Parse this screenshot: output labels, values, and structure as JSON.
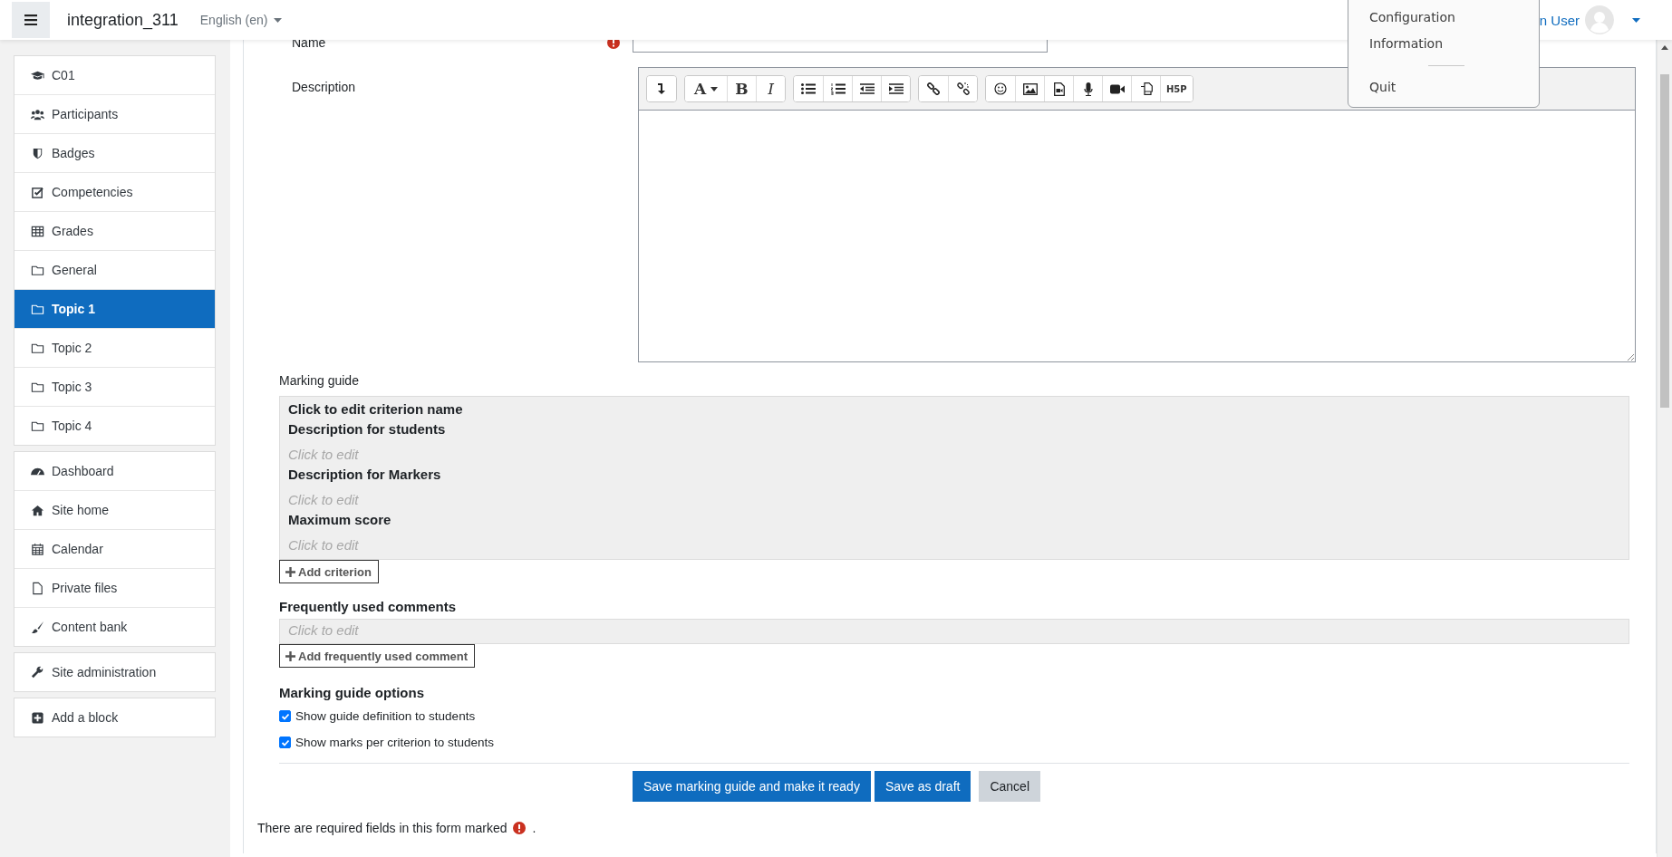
{
  "header": {
    "title": "integration_311",
    "language": "English (en)",
    "user_name": "n User"
  },
  "user_menu": {
    "items": [
      {
        "kind": "item",
        "label": "Configuration"
      },
      {
        "kind": "item",
        "label": "Information"
      },
      {
        "kind": "divider"
      },
      {
        "kind": "item",
        "label": "Quit"
      }
    ]
  },
  "sidebar": {
    "blocks": [
      {
        "items": [
          {
            "label": "C01",
            "selected": false
          },
          {
            "label": "Participants",
            "selected": false
          },
          {
            "label": "Badges",
            "selected": false
          },
          {
            "label": "Competencies",
            "selected": false
          },
          {
            "label": "Grades",
            "selected": false
          },
          {
            "label": "General",
            "selected": false
          },
          {
            "label": "Topic 1",
            "selected": true
          },
          {
            "label": "Topic 2",
            "selected": false
          },
          {
            "label": "Topic 3",
            "selected": false
          },
          {
            "label": "Topic 4",
            "selected": false
          }
        ]
      },
      {
        "items": [
          {
            "label": "Dashboard",
            "selected": false
          },
          {
            "label": "Site home",
            "selected": false
          },
          {
            "label": "Calendar",
            "selected": false
          },
          {
            "label": "Private files",
            "selected": false
          },
          {
            "label": "Content bank",
            "selected": false
          }
        ]
      },
      {
        "items": [
          {
            "label": "Site administration",
            "selected": false
          }
        ]
      },
      {
        "items": [
          {
            "label": "Add a block",
            "selected": false
          }
        ]
      }
    ]
  },
  "form": {
    "name_label": "Name",
    "description_label": "Description",
    "toolbar": {
      "font": "A",
      "bold": "B",
      "italic": "I",
      "h5p": "H5P"
    }
  },
  "marking_guide": {
    "label": "Marking guide",
    "criteria": [
      {
        "name": "Click to edit criterion name",
        "fields": [
          {
            "label": "Description for students",
            "text": "Click to edit"
          },
          {
            "label": "Description for Markers",
            "text": "Click to edit"
          },
          {
            "label": "Maximum score",
            "text": "Click to edit"
          }
        ]
      }
    ],
    "add_criterion": "Add criterion",
    "comments_heading": "Frequently used comments",
    "comments": [
      {
        "text": "Click to edit"
      }
    ],
    "add_comment": "Add frequently used comment",
    "options_heading": "Marking guide options",
    "options": [
      {
        "label": "Show guide definition to students",
        "checked": true
      },
      {
        "label": "Show marks per criterion to students",
        "checked": true
      }
    ]
  },
  "buttons": [
    {
      "label": "Save marking guide and make it ready",
      "kind": "primary"
    },
    {
      "label": "Save as draft",
      "kind": "primary"
    },
    {
      "label": "Cancel",
      "kind": "secondary"
    }
  ],
  "required_note": {
    "before": "There are required fields in this form marked",
    "after": "."
  }
}
